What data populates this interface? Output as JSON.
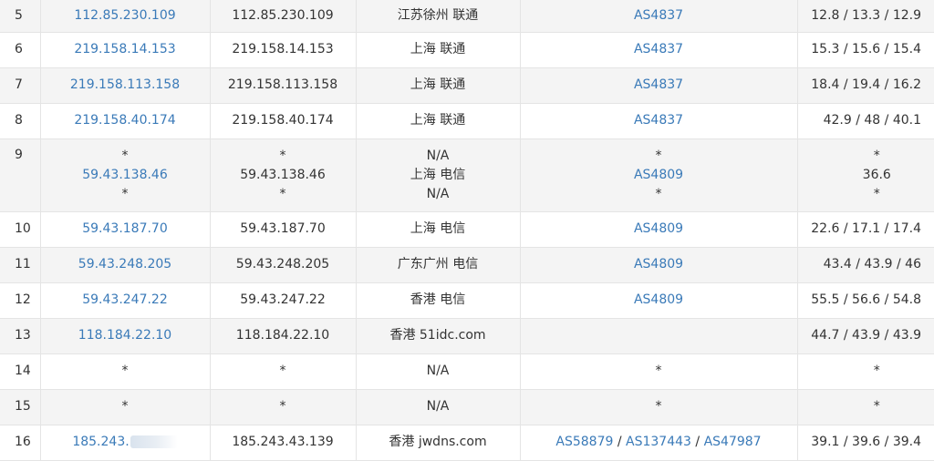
{
  "table": {
    "rows": [
      {
        "hop": "5",
        "ip_link": "112.85.230.109",
        "ip": "112.85.230.109",
        "location": "江苏徐州 联通",
        "asn": "AS4837",
        "rtt": "12.8 / 13.3 / 12.9"
      },
      {
        "hop": "6",
        "ip_link": "219.158.14.153",
        "ip": "219.158.14.153",
        "location": "上海 联通",
        "asn": "AS4837",
        "rtt": "15.3 / 15.6 / 15.4"
      },
      {
        "hop": "7",
        "ip_link": "219.158.113.158",
        "ip": "219.158.113.158",
        "location": "上海 联通",
        "asn": "AS4837",
        "rtt": "18.4 / 19.4 / 16.2"
      },
      {
        "hop": "8",
        "ip_link": "219.158.40.174",
        "ip": "219.158.40.174",
        "location": "上海 联通",
        "asn": "AS4837",
        "rtt": "42.9 / 48 / 40.1"
      },
      {
        "hop": "9",
        "ip_link_lines": [
          "*",
          "59.43.138.46",
          "*"
        ],
        "ip_lines": [
          "*",
          "59.43.138.46",
          "*"
        ],
        "location_lines": [
          "N/A",
          "上海 电信",
          "N/A"
        ],
        "asn_lines": [
          "*",
          "AS4809",
          "*"
        ],
        "rtt_lines": [
          "*",
          "36.6",
          "*"
        ]
      },
      {
        "hop": "10",
        "ip_link": "59.43.187.70",
        "ip": "59.43.187.70",
        "location": "上海 电信",
        "asn": "AS4809",
        "rtt": "22.6 / 17.1 / 17.4"
      },
      {
        "hop": "11",
        "ip_link": "59.43.248.205",
        "ip": "59.43.248.205",
        "location": "广东广州 电信",
        "asn": "AS4809",
        "rtt": "43.4 / 43.9 / 46"
      },
      {
        "hop": "12",
        "ip_link": "59.43.247.22",
        "ip": "59.43.247.22",
        "location": "香港 电信",
        "asn": "AS4809",
        "rtt": "55.5 / 56.6 / 54.8"
      },
      {
        "hop": "13",
        "ip_link": "118.184.22.10",
        "ip": "118.184.22.10",
        "location": "香港 51idc.com",
        "asn": "",
        "rtt": "44.7 / 43.9 / 43.9"
      },
      {
        "hop": "14",
        "ip_link": "*",
        "ip": "*",
        "location": "N/A",
        "asn": "*",
        "rtt": "*"
      },
      {
        "hop": "15",
        "ip_link": "*",
        "ip": "*",
        "location": "N/A",
        "asn": "*",
        "rtt": "*"
      },
      {
        "hop": "16",
        "ip_link": "185.243.",
        "ip": "185.243.43.139",
        "location": "香港 jwdns.com",
        "asn_list": [
          "AS58879",
          "AS137443",
          "AS47987"
        ],
        "rtt": "39.1 / 39.6 / 39.4"
      }
    ]
  }
}
